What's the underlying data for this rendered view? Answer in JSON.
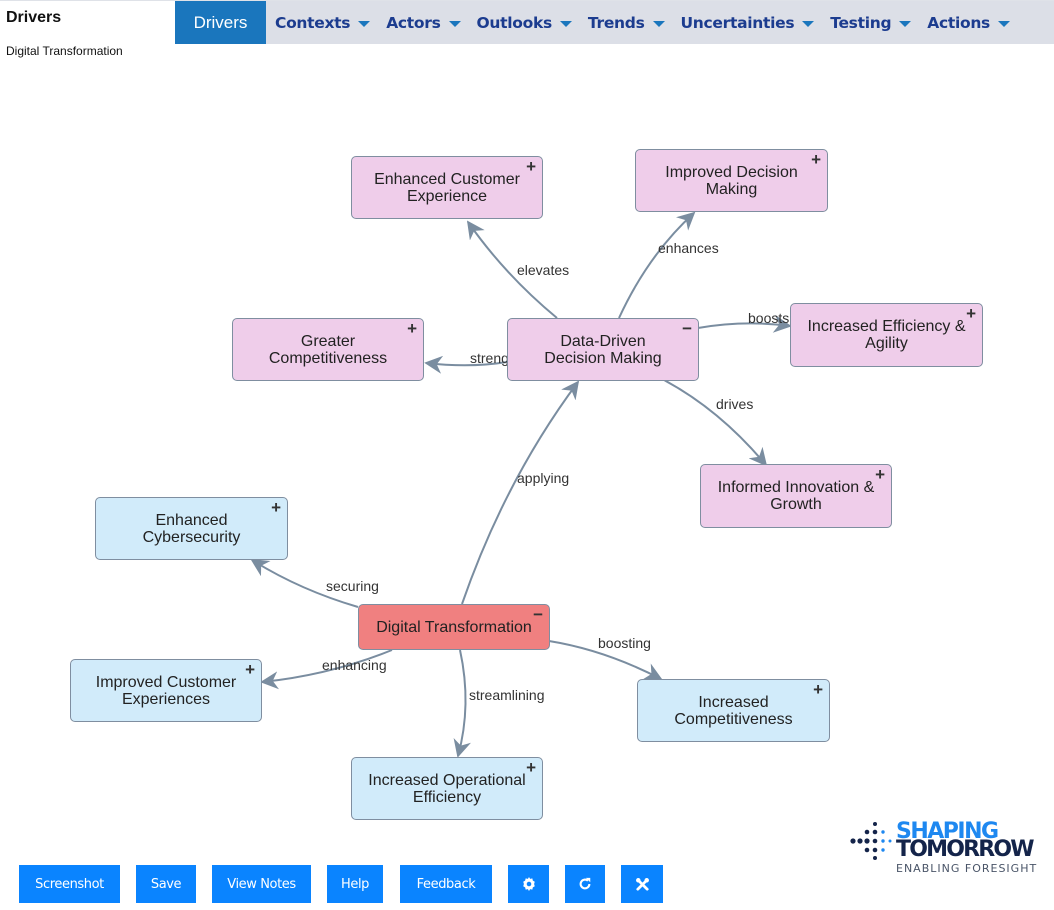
{
  "header": {
    "title": "Drivers",
    "subtitle": "Digital Transformation"
  },
  "nav": {
    "items": [
      {
        "label": "Drivers",
        "active": true,
        "dropdown": false
      },
      {
        "label": "Contexts",
        "active": false,
        "dropdown": true
      },
      {
        "label": "Actors",
        "active": false,
        "dropdown": true
      },
      {
        "label": "Outlooks",
        "active": false,
        "dropdown": true
      },
      {
        "label": "Trends",
        "active": false,
        "dropdown": true
      },
      {
        "label": "Uncertainties",
        "active": false,
        "dropdown": true
      },
      {
        "label": "Testing",
        "active": false,
        "dropdown": true
      },
      {
        "label": "Actions",
        "active": false,
        "dropdown": true
      }
    ]
  },
  "colors": {
    "nav_active": "#1a76bd",
    "nav_text": "#1c3c8f",
    "node_root": "#f08080",
    "node_pink": "#efcdea",
    "node_blue": "#d1ebfa",
    "edge": "#7a8da0",
    "button": "#0a84ff"
  },
  "diagram": {
    "nodes": [
      {
        "id": "dt",
        "label": "Digital Transformation",
        "color": "red",
        "toggle": "−"
      },
      {
        "id": "dddm",
        "label": "Data-Driven Decision Making",
        "color": "pink",
        "toggle": "−"
      },
      {
        "id": "ece",
        "label": "Enhanced Customer Experience",
        "color": "pink",
        "toggle": "+"
      },
      {
        "id": "idm",
        "label": "Improved Decision Making",
        "color": "pink",
        "toggle": "+"
      },
      {
        "id": "gc",
        "label": "Greater Competitiveness",
        "color": "pink",
        "toggle": "+"
      },
      {
        "id": "iea",
        "label": "Increased Efficiency & Agility",
        "color": "pink",
        "toggle": "+"
      },
      {
        "id": "iig",
        "label": "Informed Innovation & Growth",
        "color": "pink",
        "toggle": "+"
      },
      {
        "id": "ec",
        "label": "Enhanced Cybersecurity",
        "color": "blue",
        "toggle": "+"
      },
      {
        "id": "ice",
        "label": "Improved Customer Experiences",
        "color": "blue",
        "toggle": "+"
      },
      {
        "id": "ic",
        "label": "Increased Competitiveness",
        "color": "blue",
        "toggle": "+"
      },
      {
        "id": "ioe",
        "label": "Increased Operational Efficiency",
        "color": "blue",
        "toggle": "+"
      }
    ],
    "edges": [
      {
        "from": "dt",
        "to": "dddm",
        "label": "applying"
      },
      {
        "from": "dddm",
        "to": "ece",
        "label": "elevates"
      },
      {
        "from": "dddm",
        "to": "idm",
        "label": "enhances"
      },
      {
        "from": "dddm",
        "to": "gc",
        "label": "strengthens"
      },
      {
        "from": "dddm",
        "to": "iea",
        "label": "boosts"
      },
      {
        "from": "dddm",
        "to": "iig",
        "label": "drives"
      },
      {
        "from": "dt",
        "to": "ec",
        "label": "securing"
      },
      {
        "from": "dt",
        "to": "ice",
        "label": "enhancing"
      },
      {
        "from": "dt",
        "to": "ioe",
        "label": "streamlining"
      },
      {
        "from": "dt",
        "to": "ic",
        "label": "boosting"
      }
    ]
  },
  "toolbar": {
    "buttons": [
      {
        "label": "Screenshot"
      },
      {
        "label": "Save"
      },
      {
        "label": "View Notes"
      },
      {
        "label": "Help"
      },
      {
        "label": "Feedback"
      },
      {
        "icon": "gear-icon"
      },
      {
        "icon": "refresh-icon"
      },
      {
        "icon": "tools-icon"
      }
    ]
  },
  "logo": {
    "line1": "SHAPING",
    "line2": "TOMORROW",
    "tagline": "ENABLING FORESIGHT"
  }
}
